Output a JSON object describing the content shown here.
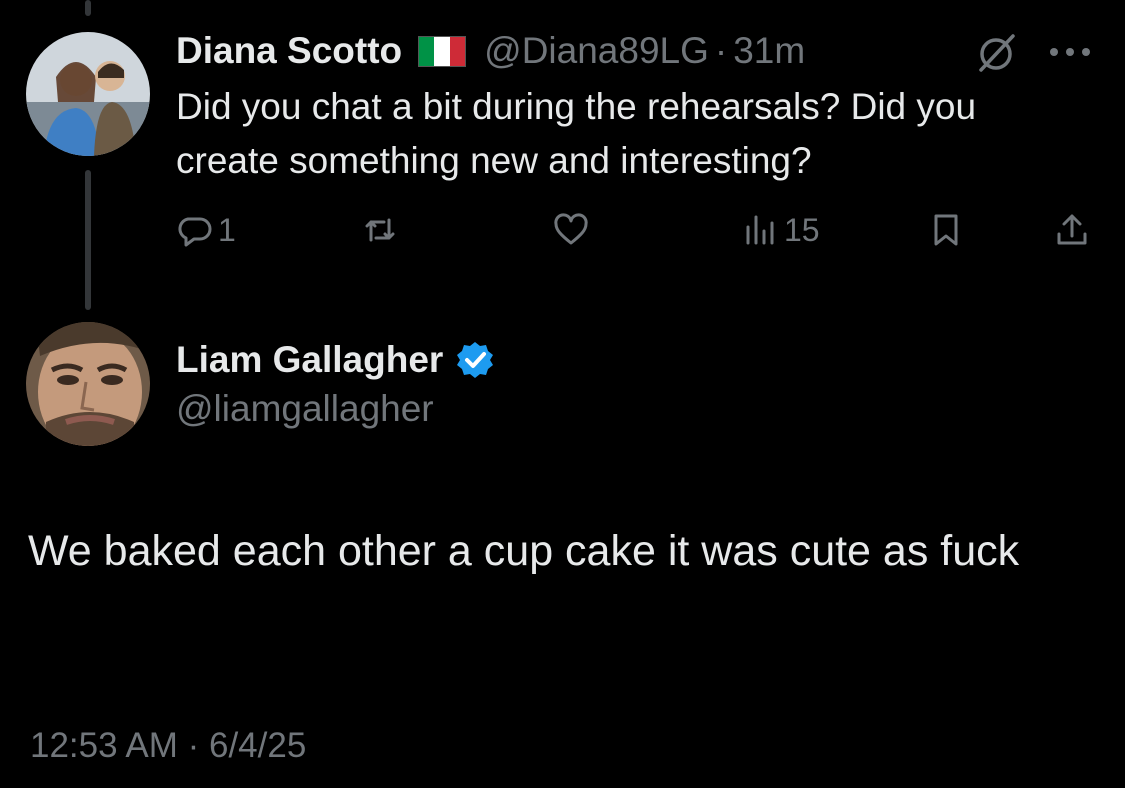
{
  "parent_tweet": {
    "display_name": "Diana Scotto",
    "flag_icon": "italy-flag-icon",
    "flag_colors": [
      "#009246",
      "#ffffff",
      "#ce2b37"
    ],
    "handle": "@Diana89LG",
    "separator": "·",
    "time": "31m",
    "text": "Did you chat a bit during the rehearsals? Did you create something new and interesting?",
    "actions": {
      "reply_count": "1",
      "retweet_count": "",
      "like_count": "",
      "views_count": "15"
    }
  },
  "main_tweet": {
    "display_name": "Liam Gallagher",
    "verified": true,
    "verified_color": "#1d9bf0",
    "handle": "@liamgallagher",
    "text": "We baked each other a cup cake it was cute as fuck",
    "timestamp": "12:53 AM · 6/4/25"
  },
  "colors": {
    "background": "#000000",
    "primary_text": "#e7e9ea",
    "secondary_text": "#71767b",
    "thread_line": "#333639"
  }
}
